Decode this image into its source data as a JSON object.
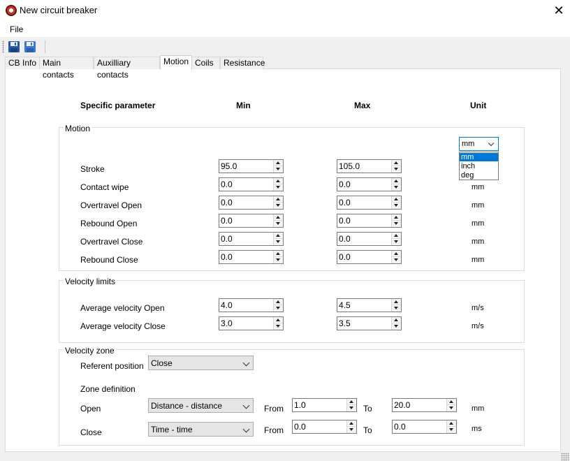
{
  "window": {
    "title": "New circuit breaker",
    "close_glyph": "✕",
    "icon": "app-logo-icon"
  },
  "menu": {
    "file": "File"
  },
  "toolbar": {
    "save_icon": "save-icon",
    "save_as_icon": "save-as-icon"
  },
  "tabs": [
    {
      "label": "CB Info",
      "active": false
    },
    {
      "label": "Main contacts",
      "active": false
    },
    {
      "label": "Auxilliary contacts",
      "active": false
    },
    {
      "label": "Motion",
      "active": true
    },
    {
      "label": "Coils",
      "active": false
    },
    {
      "label": "Resistance",
      "active": false
    }
  ],
  "headers": {
    "param": "Specific parameter",
    "min": "Min",
    "max": "Max",
    "unit": "Unit"
  },
  "motion": {
    "legend": "Motion",
    "unit_select": {
      "value": "mm",
      "options": [
        "mm",
        "inch",
        "deg"
      ],
      "highlighted": "mm"
    },
    "rows": [
      {
        "label": "Stroke",
        "min": "95.0",
        "max": "105.0",
        "unit": ""
      },
      {
        "label": "Contact wipe",
        "min": "0.0",
        "max": "0.0",
        "unit": "mm"
      },
      {
        "label": "Overtravel Open",
        "min": "0.0",
        "max": "0.0",
        "unit": "mm"
      },
      {
        "label": "Rebound Open",
        "min": "0.0",
        "max": "0.0",
        "unit": "mm"
      },
      {
        "label": "Overtravel Close",
        "min": "0.0",
        "max": "0.0",
        "unit": "mm"
      },
      {
        "label": "Rebound Close",
        "min": "0.0",
        "max": "0.0",
        "unit": "mm"
      }
    ]
  },
  "velocity_limits": {
    "legend": "Velocity limits",
    "rows": [
      {
        "label": "Average velocity Open",
        "min": "4.0",
        "max": "4.5",
        "unit": "m/s"
      },
      {
        "label": "Average velocity Close",
        "min": "3.0",
        "max": "3.5",
        "unit": "m/s"
      }
    ]
  },
  "velocity_zone": {
    "legend": "Velocity zone",
    "referent_label": "Referent position",
    "referent_value": "Close",
    "zone_definition_label": "Zone definition",
    "rows": [
      {
        "label": "Open",
        "mode": "Distance - distance",
        "from_label": "From",
        "from": "1.0",
        "to_label": "To",
        "to": "20.0",
        "unit": "mm"
      },
      {
        "label": "Close",
        "mode": "Time - time",
        "from_label": "From",
        "from": "0.0",
        "to_label": "To",
        "to": "0.0",
        "unit": "ms"
      }
    ]
  }
}
